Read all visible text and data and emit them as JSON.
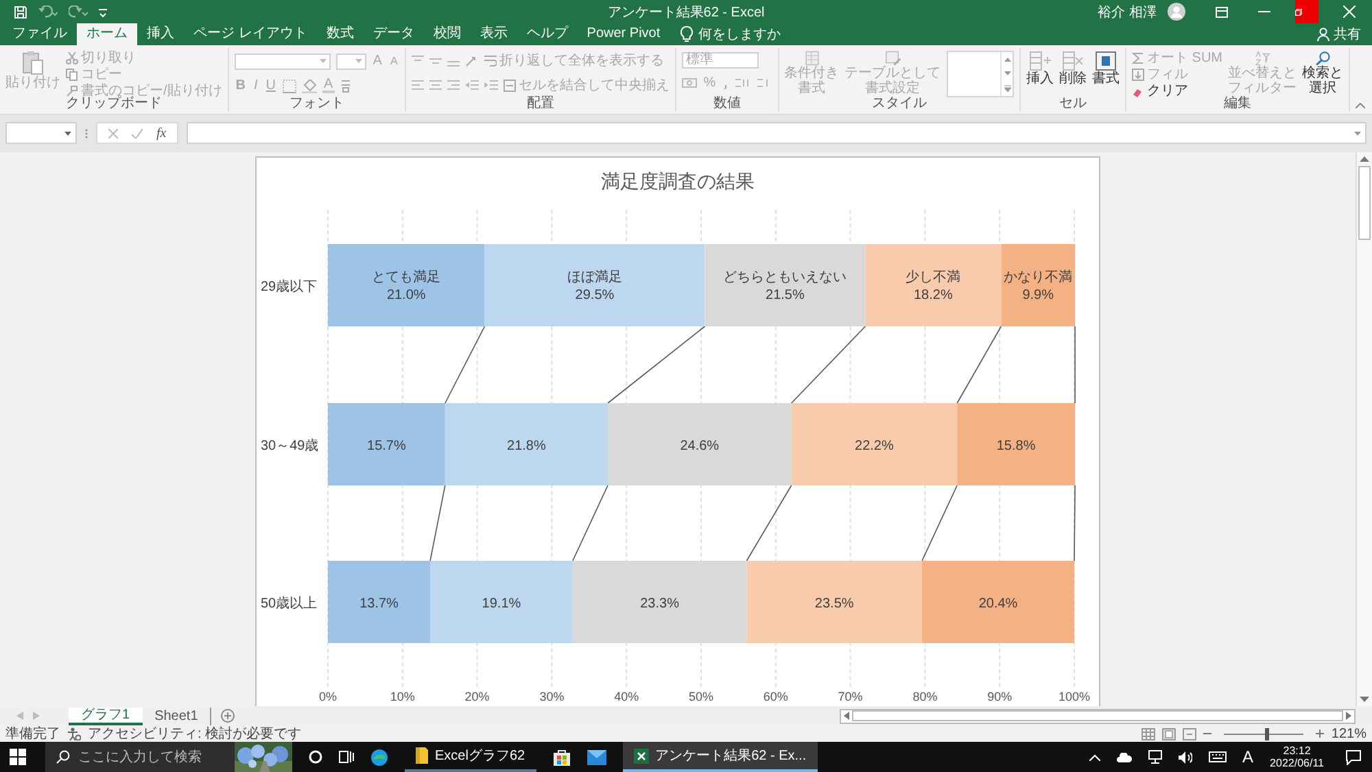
{
  "title_bar": {
    "title": "アンケート結果62 - Excel",
    "user": "裕介 相澤"
  },
  "tabs": [
    {
      "label": "ファイル",
      "selected": false
    },
    {
      "label": "ホーム",
      "selected": true
    },
    {
      "label": "挿入",
      "selected": false
    },
    {
      "label": "ページ レイアウト",
      "selected": false
    },
    {
      "label": "数式",
      "selected": false
    },
    {
      "label": "データ",
      "selected": false
    },
    {
      "label": "校閲",
      "selected": false
    },
    {
      "label": "表示",
      "selected": false
    },
    {
      "label": "ヘルプ",
      "selected": false
    },
    {
      "label": "Power Pivot",
      "selected": false
    }
  ],
  "tell_me": "何をしますか",
  "share": "共有",
  "ribbon": {
    "clipboard": {
      "label": "クリップボード",
      "paste": {
        "label": "貼り付け",
        "disabled": true
      },
      "cut": {
        "label": "切り取り",
        "disabled": true
      },
      "copy": {
        "label": "コピー",
        "disabled": true
      },
      "format_painter": {
        "label": "書式のコピー/貼り付け",
        "disabled": true
      }
    },
    "font": {
      "label": "フォント",
      "grow": {
        "label": "A",
        "disabled": true
      },
      "shrink": {
        "label": "A",
        "disabled": true
      },
      "bold": {
        "label": "B",
        "disabled": true
      },
      "italic": {
        "label": "I",
        "disabled": true
      },
      "underline": {
        "label": "U",
        "disabled": true
      },
      "font_color": {
        "label": "A",
        "disabled": true
      }
    },
    "alignment": {
      "label": "配置",
      "wrap": {
        "label": "折り返して全体を表示する",
        "disabled": true
      },
      "merge": {
        "label": "セルを結合して中央揃え",
        "disabled": true
      }
    },
    "number": {
      "label": "数値",
      "format": {
        "label": "標準",
        "disabled": true
      },
      "percent": {
        "label": "%",
        "disabled": true
      }
    },
    "styles": {
      "label": "スタイル",
      "conditional": {
        "label": "条件付き書式",
        "disabled": true
      },
      "table": {
        "label": "テーブルとして書式設定",
        "disabled": true
      }
    },
    "cells": {
      "label": "セル",
      "insert": {
        "label": "挿入",
        "disabled": false
      },
      "delete": {
        "label": "削除",
        "disabled": false
      },
      "format": {
        "label": "書式",
        "disabled": false
      }
    },
    "editing": {
      "label": "編集",
      "autosum": {
        "label": "オート SUM",
        "disabled": true
      },
      "fill": {
        "label": "フィル",
        "disabled": true
      },
      "clear": {
        "label": "クリア",
        "disabled": false
      },
      "sort": {
        "label": "並べ替えとフィルター",
        "disabled": true
      },
      "find": {
        "label": "検索と選択",
        "disabled": false
      }
    }
  },
  "formula_bar": {
    "fx": "fx"
  },
  "chart": {
    "chart_data": {
      "type": "bar",
      "orientation": "horizontal",
      "stacked": true,
      "title": "満足度調査の結果",
      "categories": [
        "29歳以下",
        "30～49歳",
        "50歳以上"
      ],
      "series": [
        {
          "name": "とても満足",
          "color": "#9dc3e6",
          "values": [
            21.0,
            15.7,
            13.7
          ],
          "value_labels": [
            "21.0%",
            "15.7%",
            "13.7%"
          ]
        },
        {
          "name": "ほぼ満足",
          "color": "#bdd7ee",
          "values": [
            29.5,
            21.8,
            19.1
          ],
          "value_labels": [
            "29.5%",
            "21.8%",
            "19.1%"
          ]
        },
        {
          "name": "どちらともいえない",
          "color": "#d9d9d9",
          "values": [
            21.5,
            24.6,
            23.3
          ],
          "value_labels": [
            "21.5%",
            "24.6%",
            "23.3%"
          ]
        },
        {
          "name": "少し不満",
          "color": "#f8cbad",
          "values": [
            18.2,
            22.2,
            23.5
          ],
          "value_labels": [
            "18.2%",
            "22.2%",
            "23.5%"
          ]
        },
        {
          "name": "かなり不満",
          "color": "#f4b183",
          "values": [
            9.9,
            15.8,
            20.4
          ],
          "value_labels": [
            "9.9%",
            "15.8%",
            "20.4%"
          ]
        }
      ],
      "xlim": [
        0,
        100
      ],
      "xticks": [
        {
          "value": 0,
          "label": "0%"
        },
        {
          "value": 10,
          "label": "10%"
        },
        {
          "value": 20,
          "label": "20%"
        },
        {
          "value": 30,
          "label": "30%"
        },
        {
          "value": 40,
          "label": "40%"
        },
        {
          "value": 50,
          "label": "50%"
        },
        {
          "value": 60,
          "label": "60%"
        },
        {
          "value": 70,
          "label": "70%"
        },
        {
          "value": 80,
          "label": "80%"
        },
        {
          "value": 90,
          "label": "90%"
        },
        {
          "value": 100,
          "label": "100%"
        }
      ],
      "grid": true,
      "data_labels": true
    }
  },
  "sheet_tabs": [
    {
      "label": "グラフ1",
      "selected": true
    },
    {
      "label": "Sheet1",
      "selected": false
    }
  ],
  "status_bar": {
    "ready": "準備完了",
    "accessibility": "アクセシビリティ: 検討が必要です",
    "zoom": "121%",
    "zoom_slider": {
      "level": 0.52
    }
  },
  "taskbar": {
    "search_placeholder": "ここに入力して検索",
    "apps": [
      {
        "label": "Excelグラフ62",
        "selected": false
      },
      {
        "label": "アンケート結果62 - Ex...",
        "selected": true
      }
    ],
    "ime": "A",
    "time": "23:12",
    "date": "2022/06/11"
  }
}
